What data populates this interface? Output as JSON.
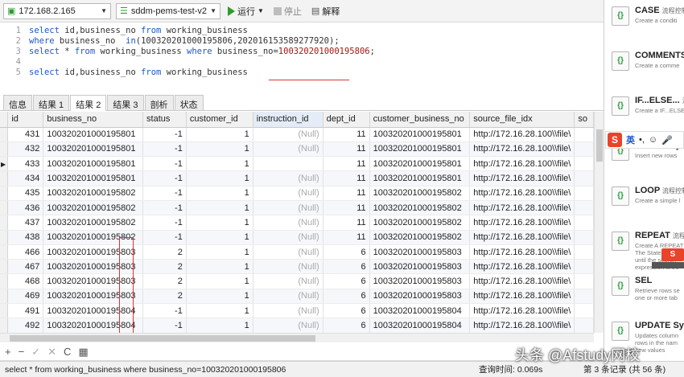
{
  "toolbar": {
    "connection": "172.168.2.165",
    "database": "sddm-pems-test-v2",
    "run_label": "运行",
    "stop_label": "停止",
    "explain_label": "解释"
  },
  "editor": {
    "lines": [
      {
        "num": "1",
        "kw1": "select",
        "t1": " id,business_no ",
        "kw2": "from",
        "t2": " working_business"
      },
      {
        "num": "2",
        "kw1": "where",
        "t1": " business_no  ",
        "kw2": "in",
        "t2": "(100320201000195806,202016153589277920);"
      },
      {
        "num": "3",
        "kw1": "select",
        "t1": " * ",
        "kw2": "from",
        "t2": " working_business ",
        "kw3": "where",
        "t3": " business_no=",
        "t4": "100320201000195806",
        "t5": ";"
      },
      {
        "num": "4"
      },
      {
        "num": "5",
        "kw1": "select",
        "t1": " id,business_no ",
        "kw2": "from",
        "t2": " working_business"
      }
    ]
  },
  "tabs": [
    "信息",
    "结果 1",
    "结果 2",
    "结果 3",
    "剖析",
    "状态"
  ],
  "grid": {
    "columns": [
      "id",
      "business_no",
      "status",
      "customer_id",
      "instruction_id",
      "dept_id",
      "customer_business_no",
      "source_file_idx",
      "so"
    ],
    "rows": [
      [
        "431",
        "100320201000195801",
        "-1",
        "1",
        "(Null)",
        "11",
        "100320201000195801",
        "http://172.16.28.100\\\\file\\"
      ],
      [
        "432",
        "100320201000195801",
        "-1",
        "1",
        "(Null)",
        "11",
        "100320201000195801",
        "http://172.16.28.100\\\\file\\"
      ],
      [
        "433",
        "100320201000195801",
        "-1",
        "1",
        "",
        "11",
        "100320201000195801",
        "http://172.16.28.100\\\\file\\"
      ],
      [
        "434",
        "100320201000195801",
        "-1",
        "1",
        "(Null)",
        "11",
        "100320201000195801",
        "http://172.16.28.100\\\\file\\"
      ],
      [
        "435",
        "100320201000195802",
        "-1",
        "1",
        "(Null)",
        "11",
        "100320201000195802",
        "http://172.16.28.100\\\\file\\"
      ],
      [
        "436",
        "100320201000195802",
        "-1",
        "1",
        "(Null)",
        "11",
        "100320201000195802",
        "http://172.16.28.100\\\\file\\"
      ],
      [
        "437",
        "100320201000195802",
        "-1",
        "1",
        "(Null)",
        "11",
        "100320201000195802",
        "http://172.16.28.100\\\\file\\"
      ],
      [
        "438",
        "100320201000195802",
        "-1",
        "1",
        "(Null)",
        "11",
        "100320201000195802",
        "http://172.16.28.100\\\\file\\"
      ],
      [
        "466",
        "100320201000195803",
        "2",
        "1",
        "(Null)",
        "6",
        "100320201000195803",
        "http://172.16.28.100\\\\file\\"
      ],
      [
        "467",
        "100320201000195803",
        "2",
        "1",
        "(Null)",
        "6",
        "100320201000195803",
        "http://172.16.28.100\\\\file\\"
      ],
      [
        "468",
        "100320201000195803",
        "2",
        "1",
        "(Null)",
        "6",
        "100320201000195803",
        "http://172.16.28.100\\\\file\\"
      ],
      [
        "469",
        "100320201000195803",
        "2",
        "1",
        "(Null)",
        "6",
        "100320201000195803",
        "http://172.16.28.100\\\\file\\"
      ],
      [
        "491",
        "100320201000195804",
        "-1",
        "1",
        "(Null)",
        "6",
        "100320201000195804",
        "http://172.16.28.100\\\\file\\"
      ],
      [
        "492",
        "100320201000195804",
        "-1",
        "1",
        "(Null)",
        "6",
        "100320201000195804",
        "http://172.16.28.100\\\\file\\"
      ]
    ]
  },
  "bottom_buttons": [
    "+",
    "−",
    "✓",
    "✕",
    "C",
    "▦"
  ],
  "status": {
    "sql": "select * from working_business where business_no=100320201000195806",
    "time": "查询时间: 0.069s",
    "records": "第 3 条记录 (共 56 条)"
  },
  "snippets": [
    {
      "title": "CASE",
      "tag": "流程控制",
      "desc": "Create a conditi"
    },
    {
      "title": "COMMENTS",
      "tag": "",
      "desc": "Create a comme"
    },
    {
      "title": "IF...ELSE...",
      "tag": "流程控",
      "desc": "Create a IF...ELSE"
    },
    {
      "title": "INSERT Syn",
      "tag": "",
      "desc": "Insert new rows"
    },
    {
      "title": "LOOP",
      "tag": "流程控制",
      "desc": "Create a simple l"
    },
    {
      "title": "REPEAT",
      "tag": "流程",
      "desc": "Create A REPEAT|The Statement li|until the search_|expression is tru"
    },
    {
      "title": "SEL",
      "tag": "",
      "desc": "Retrieve rows se|one or more tab"
    },
    {
      "title": "UPDATE Sy",
      "tag": "",
      "desc": "Updates column|rows in the nam|new values"
    }
  ],
  "ime": {
    "logo": "S",
    "lang": "英"
  },
  "sidebar_search": "搜索",
  "watermark": "头条 @Afstudy网校",
  "colors": {
    "highlight_box": "#dd3333",
    "keyword": "#1a57c9",
    "run_green": "#2e9b2e"
  }
}
